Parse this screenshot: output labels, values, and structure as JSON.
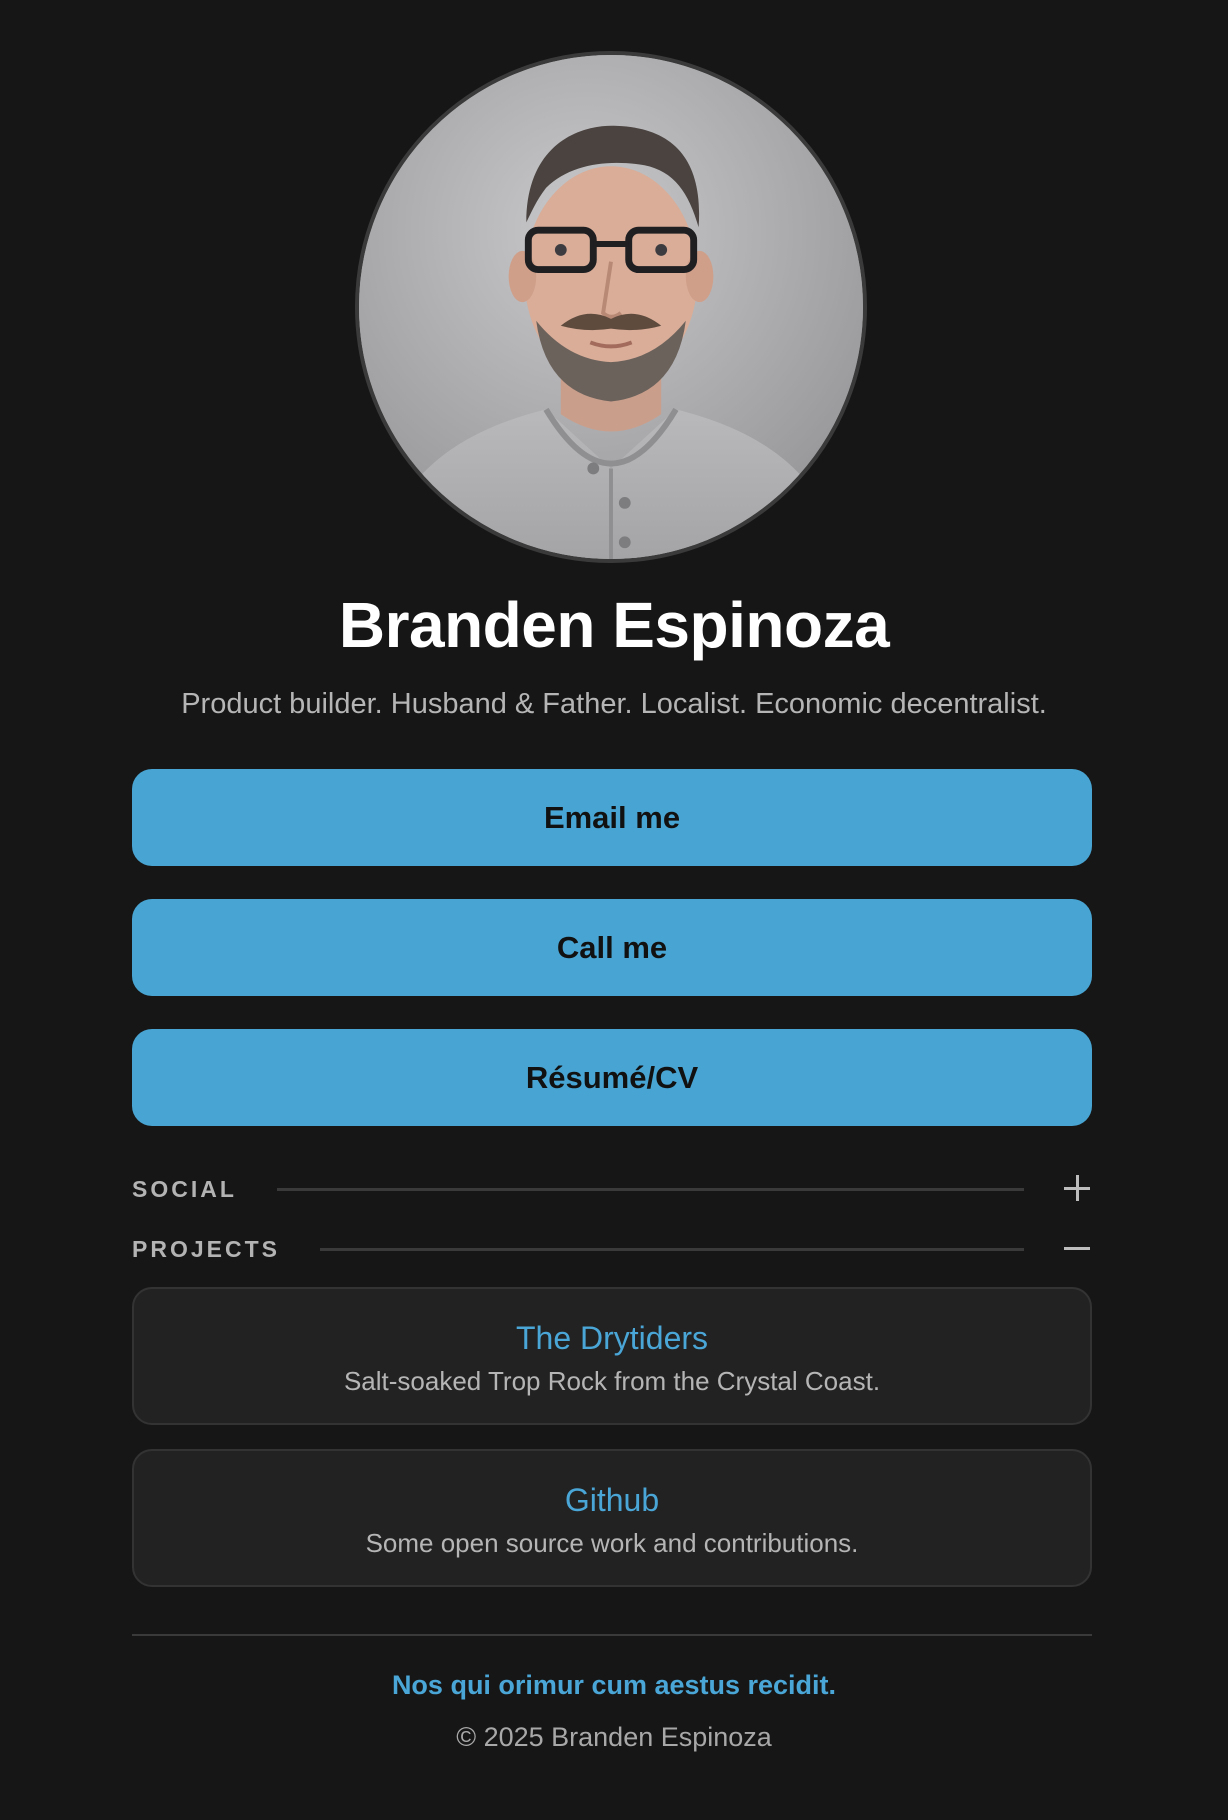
{
  "profile": {
    "name": "Branden Espinoza",
    "tagline": "Product builder. Husband & Father. Localist. Economic decentralist."
  },
  "buttons": [
    {
      "label": "Email me"
    },
    {
      "label": "Call me"
    },
    {
      "label": "Résumé/CV"
    }
  ],
  "sections": {
    "social": {
      "label": "SOCIAL",
      "toggle_icon": "plus-icon",
      "expanded": false
    },
    "projects": {
      "label": "PROJECTS",
      "toggle_icon": "minus-icon",
      "expanded": true
    }
  },
  "projects": [
    {
      "title": "The Drytiders",
      "description": "Salt-soaked Trop Rock from the Crystal Coast."
    },
    {
      "title": "Github",
      "description": "Some open source work and contributions."
    }
  ],
  "footer": {
    "motto": "Nos qui orimur cum aestus recidit.",
    "copyright": "© 2025 Branden Espinoza"
  },
  "colors": {
    "background": "#161616",
    "accent": "#48a4d2",
    "card": "#222222"
  }
}
